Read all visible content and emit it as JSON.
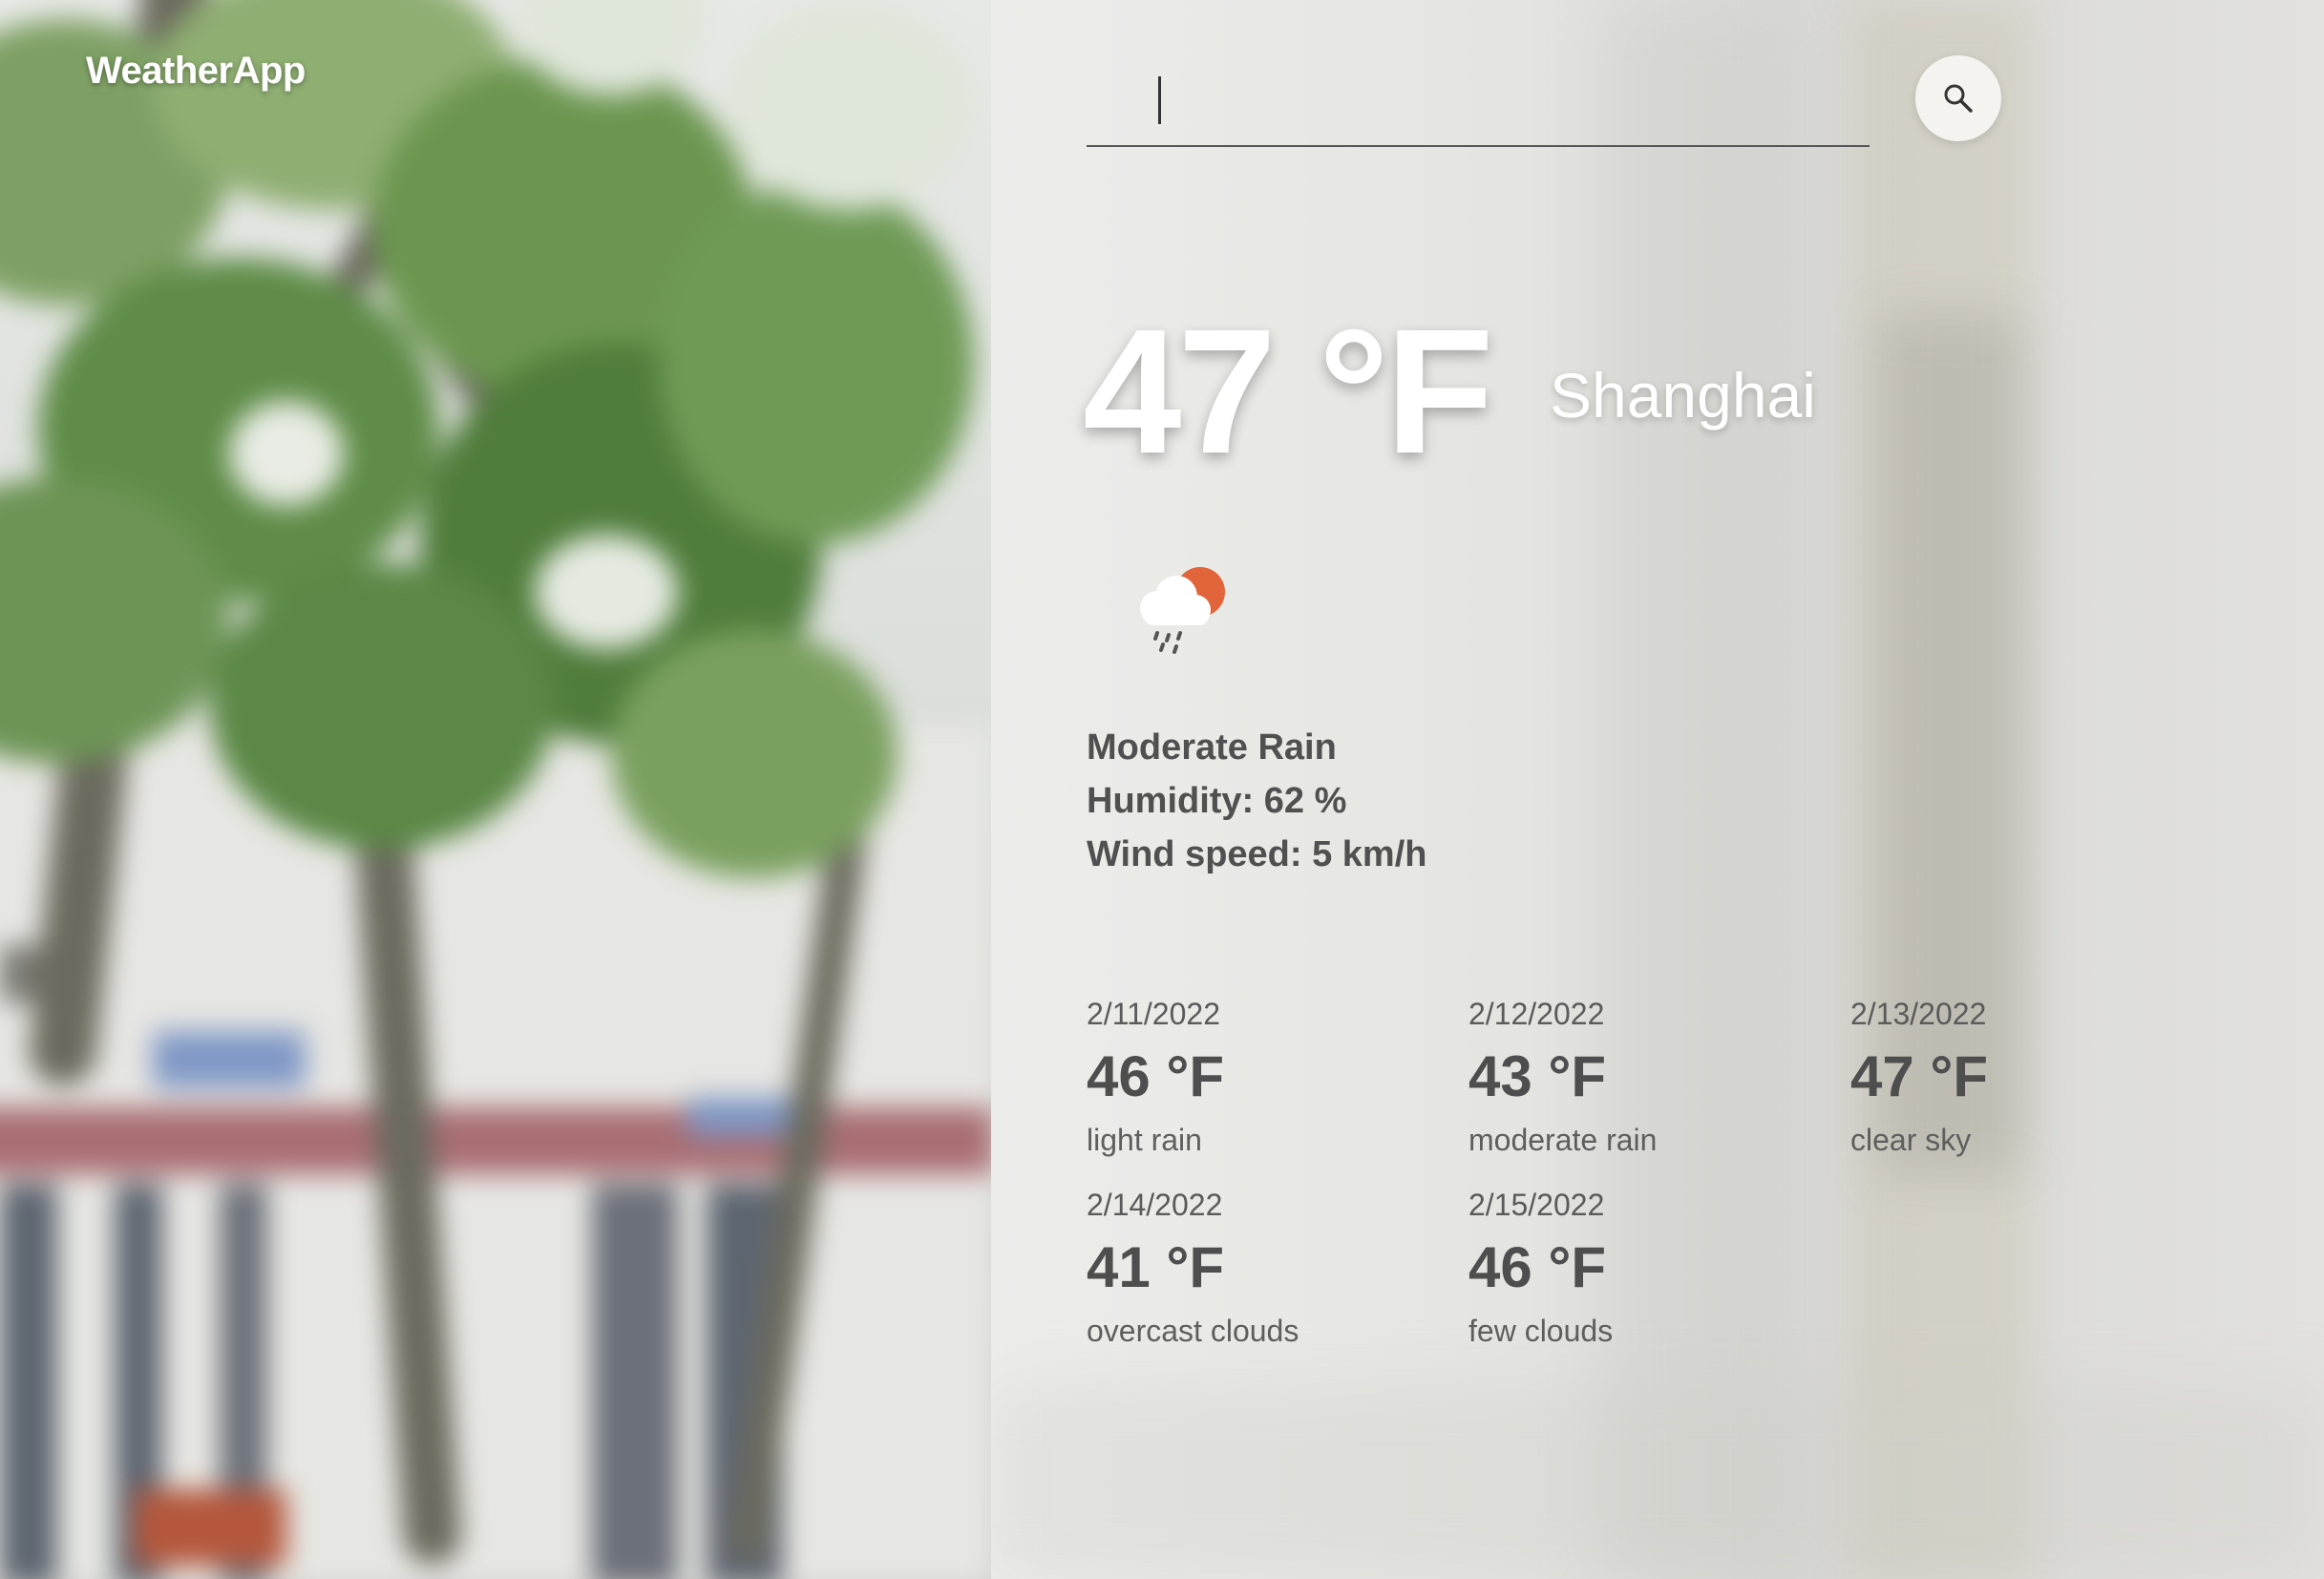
{
  "app": {
    "brand": "WeatherApp"
  },
  "search": {
    "value": "",
    "placeholder": ""
  },
  "current": {
    "temperature": "47 °F",
    "city": "Shanghai",
    "icon": "cloud-sun-rain-icon",
    "condition": "Moderate Rain",
    "humidity": "Humidity: 62 %",
    "wind": "Wind speed: 5 km/h"
  },
  "forecast": [
    {
      "date": "2/11/2022",
      "temp": "46 °F",
      "desc": "light rain"
    },
    {
      "date": "2/12/2022",
      "temp": "43 °F",
      "desc": "moderate rain"
    },
    {
      "date": "2/13/2022",
      "temp": "47 °F",
      "desc": "clear sky"
    },
    {
      "date": "2/14/2022",
      "temp": "41 °F",
      "desc": "overcast clouds"
    },
    {
      "date": "2/15/2022",
      "temp": "46 °F",
      "desc": "few clouds"
    }
  ],
  "colors": {
    "sun": "#e2643a",
    "cloud": "#ffffff",
    "text_dark": "#505050",
    "text_light": "#ffffff"
  }
}
